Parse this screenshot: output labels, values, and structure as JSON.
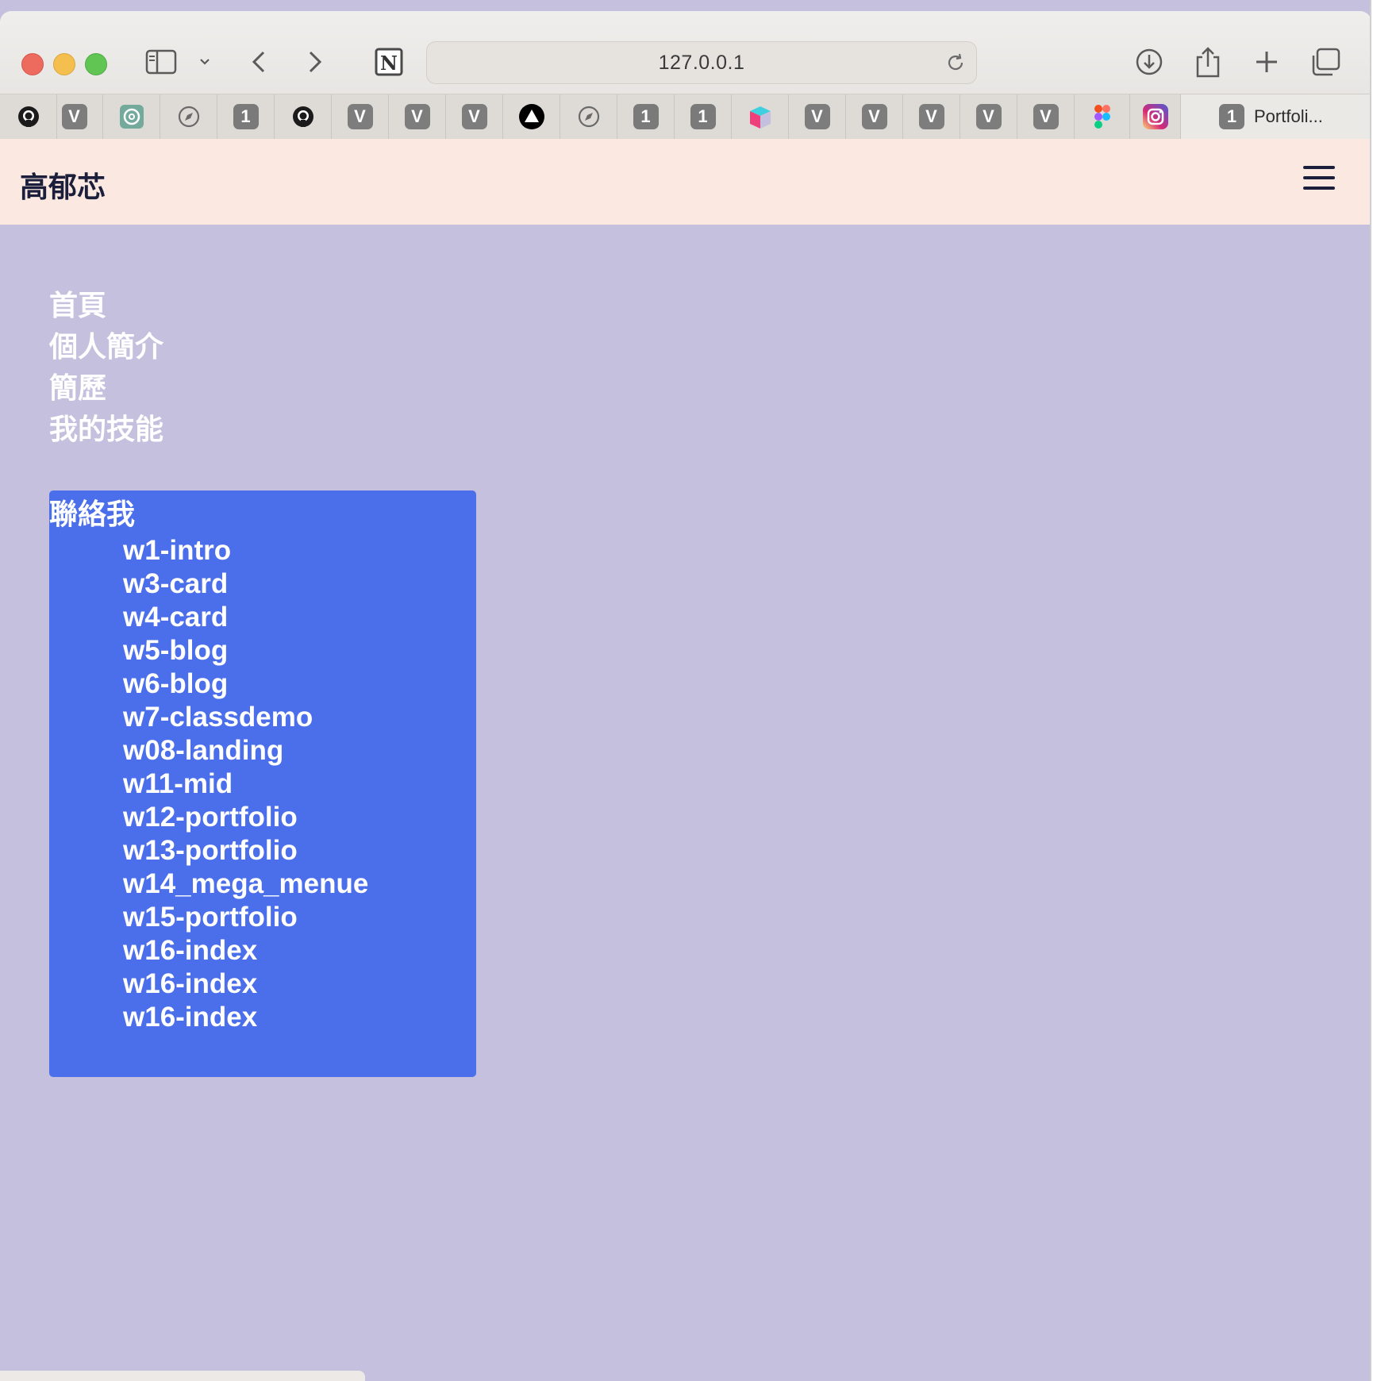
{
  "browser": {
    "url": "127.0.0.1",
    "tabs": [
      {
        "icon": "github-icon"
      },
      {
        "icon": "v-badge-icon",
        "label": "V"
      },
      {
        "icon": "chatgpt-icon"
      },
      {
        "icon": "compass-icon"
      },
      {
        "icon": "one-badge-icon",
        "label": "1"
      },
      {
        "icon": "github-icon"
      },
      {
        "icon": "v-badge-icon",
        "label": "V"
      },
      {
        "icon": "v-badge-icon",
        "label": "V"
      },
      {
        "icon": "v-badge-icon",
        "label": "V"
      },
      {
        "icon": "triangle-logo-icon"
      },
      {
        "icon": "compass-icon"
      },
      {
        "icon": "one-badge-icon",
        "label": "1"
      },
      {
        "icon": "one-badge-icon",
        "label": "1"
      },
      {
        "icon": "cube-logo-icon"
      },
      {
        "icon": "v-badge-icon",
        "label": "V"
      },
      {
        "icon": "v-badge-icon",
        "label": "V"
      },
      {
        "icon": "v-badge-icon",
        "label": "V"
      },
      {
        "icon": "v-badge-icon",
        "label": "V"
      },
      {
        "icon": "v-badge-icon",
        "label": "V"
      },
      {
        "icon": "figma-icon"
      },
      {
        "icon": "instagram-icon"
      }
    ],
    "active_tab": {
      "badge": "1",
      "title": "Portfoli..."
    }
  },
  "site": {
    "brand": "高郁芯",
    "nav": [
      "首頁",
      "個人簡介",
      "簡歷",
      "我的技能"
    ],
    "dropdown": {
      "title": "聯絡我",
      "items": [
        "w1-intro",
        "w3-card",
        "w4-card",
        "w5-blog",
        "w6-blog",
        "w7-classdemo",
        "w08-landing",
        "w11-mid",
        "w12-portfolio",
        "w13-portfolio",
        "w14_mega_menue",
        "w15-portfolio",
        "w16-index",
        "w16-index",
        "w16-index"
      ]
    }
  },
  "colors": {
    "header_bg": "#fbe8e0",
    "page_bg": "#c4c0de",
    "dropdown_bg": "#4b6eeb",
    "brand_text": "#1b1f3b"
  }
}
